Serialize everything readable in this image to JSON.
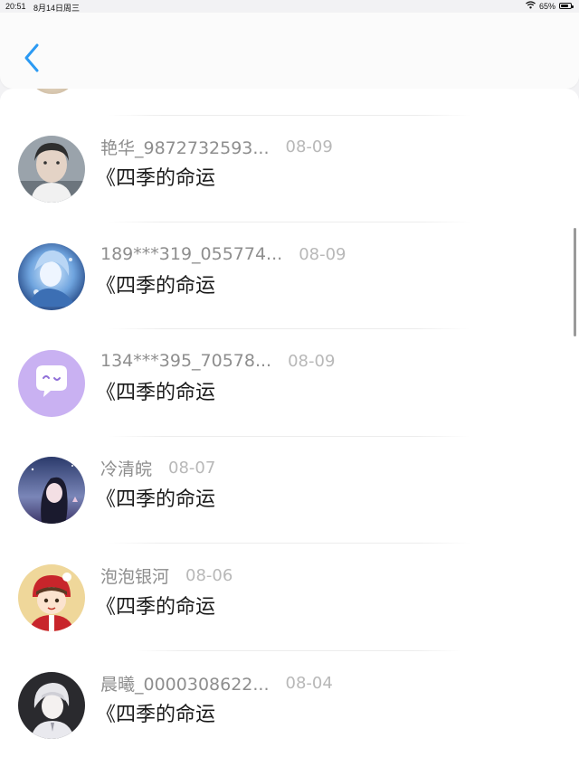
{
  "status_bar": {
    "time": "20:51",
    "date": "8月14日周三",
    "battery": "65%",
    "battery_level": 0.65
  },
  "nav": {
    "back_icon": "chevron-left-icon",
    "accent_color": "#2b9af3"
  },
  "messages": [
    {
      "user": "艳华_9872732593...",
      "date": "08-09",
      "title": "《四季的命运",
      "avatar_icon": "photo-avatar-icon"
    },
    {
      "user": "189***319_055774...",
      "date": "08-09",
      "title": "《四季的命运",
      "avatar_icon": "anime-blue-avatar-icon"
    },
    {
      "user": "134***395_70578...",
      "date": "08-09",
      "title": "《四季的命运",
      "avatar_icon": "chat-bubble-avatar-icon"
    },
    {
      "user": "冷清皖",
      "date": "08-07",
      "title": "《四季的命运",
      "avatar_icon": "anime-girl-avatar-icon"
    },
    {
      "user": "泡泡银河",
      "date": "08-06",
      "title": "《四季的命运",
      "avatar_icon": "cartoon-kid-avatar-icon"
    },
    {
      "user": "晨曦_0000308622...",
      "date": "08-04",
      "title": "《四季的命运",
      "avatar_icon": "anime-boy-avatar-icon"
    }
  ]
}
